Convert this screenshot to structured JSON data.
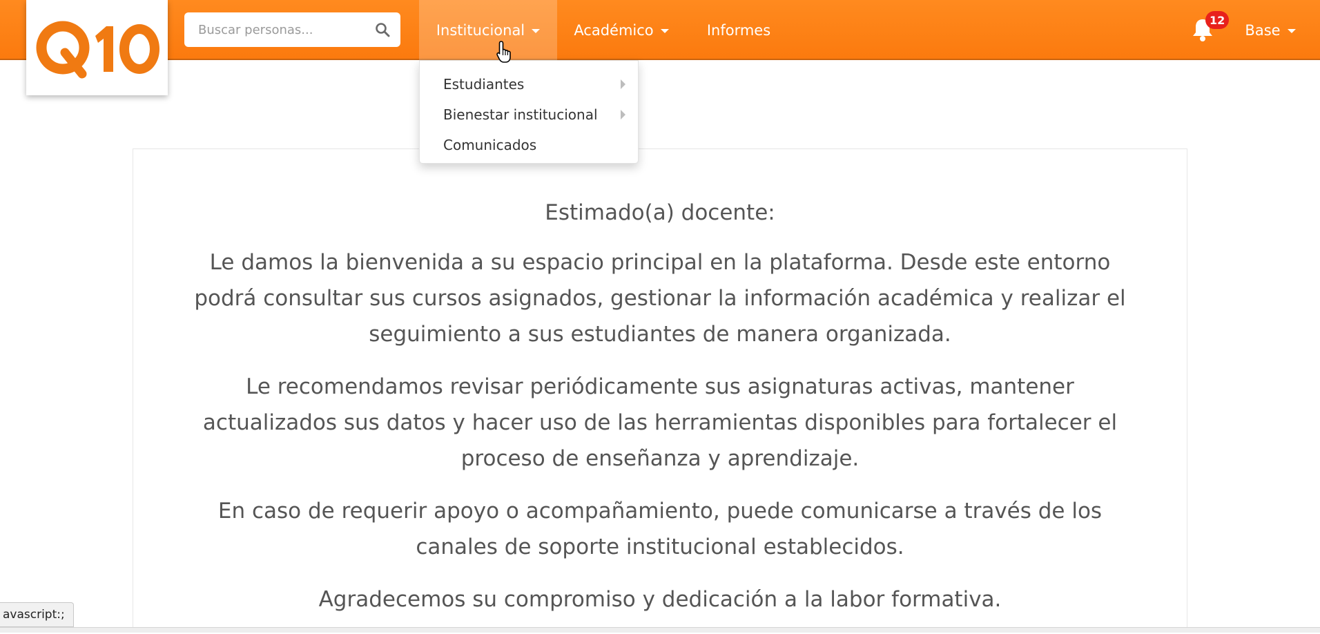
{
  "brand": {
    "logo_text": "Q10",
    "accent_color": "#fb7a0e"
  },
  "search": {
    "placeholder": "Buscar personas..."
  },
  "nav": {
    "institucional": "Institucional",
    "academico": "Académico",
    "informes": "Informes",
    "base": "Base"
  },
  "notifications": {
    "count": "12"
  },
  "dropdown": {
    "items": [
      {
        "label": "Estudiantes",
        "has_submenu": true
      },
      {
        "label": "Bienestar institucional",
        "has_submenu": true
      },
      {
        "label": "Comunicados",
        "has_submenu": false
      }
    ]
  },
  "message": {
    "greeting": "Estimado(a) docente:",
    "paragraphs": [
      "Le damos la bienvenida a su espacio principal en la plataforma. Desde este entorno podrá consultar sus cursos asignados, gestionar la información académica y realizar el seguimiento a sus estudiantes de manera organizada.",
      "Le recomendamos revisar periódicamente sus asignaturas activas, mantener actualizados sus datos y hacer uso de las herramientas disponibles para fortalecer el proceso de enseñanza y aprendizaje.",
      "En caso de requerir apoyo o acompañamiento, puede comunicarse a través de los canales de soporte institucional establecidos.",
      "Agradecemos su compromiso y dedicación a la labor formativa."
    ]
  },
  "status_bar": {
    "text": "avascript:;"
  }
}
